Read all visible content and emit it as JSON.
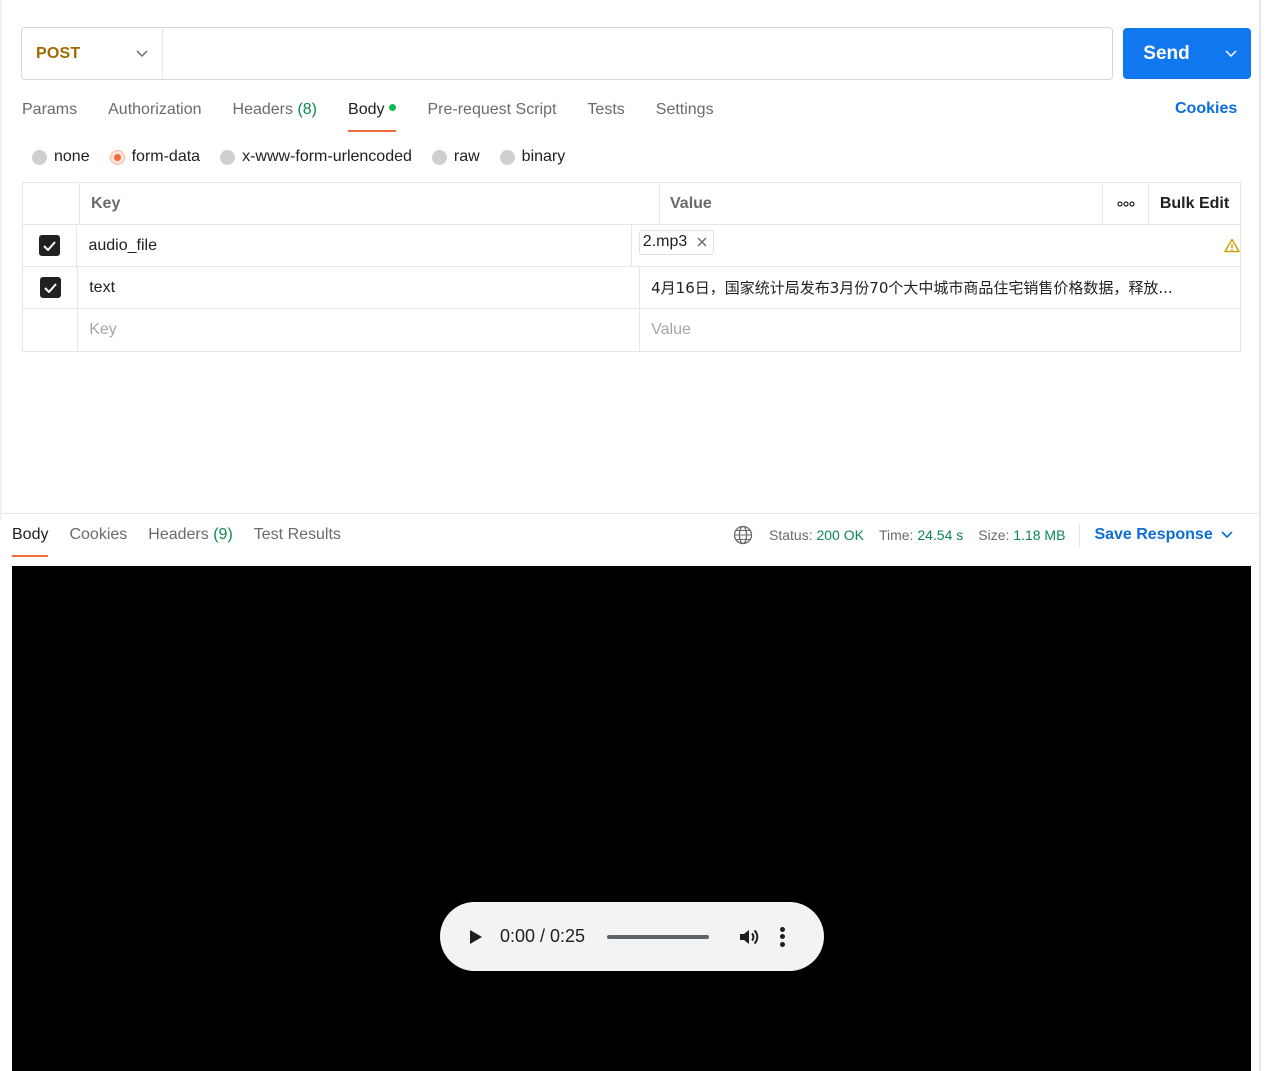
{
  "request": {
    "method": "POST",
    "url": "",
    "send_label": "Send",
    "tabs": [
      {
        "label": "Params"
      },
      {
        "label": "Authorization"
      },
      {
        "label": "Headers",
        "count": "(8)"
      },
      {
        "label": "Body"
      },
      {
        "label": "Pre-request Script"
      },
      {
        "label": "Tests"
      },
      {
        "label": "Settings"
      }
    ],
    "cookies_label": "Cookies",
    "body_types": [
      "none",
      "form-data",
      "x-www-form-urlencoded",
      "raw",
      "binary"
    ],
    "selected_body_type": "form-data"
  },
  "table": {
    "key_header": "Key",
    "value_header": "Value",
    "more_icon": "more-horizontal-icon",
    "bulk_edit_label": "Bulk Edit",
    "rows": [
      {
        "key": "audio_file",
        "value": "2.mp3",
        "type": "file",
        "checked": true
      },
      {
        "key": "text",
        "value": "4月16日，国家统计局发布3月份70个大中城市商品住宅销售价格数据，释放...",
        "type": "text",
        "checked": true
      }
    ],
    "key_placeholder": "Key",
    "value_placeholder": "Value"
  },
  "response": {
    "tabs": [
      {
        "label": "Body"
      },
      {
        "label": "Cookies"
      },
      {
        "label": "Headers",
        "count": "(9)"
      },
      {
        "label": "Test Results"
      }
    ],
    "status_label": "Status:",
    "status_value": "200 OK",
    "time_label": "Time:",
    "time_value": "24.54 s",
    "size_label": "Size:",
    "size_value": "1.18 MB",
    "save_label": "Save Response",
    "audio": {
      "time_display": "0:00 / 0:25"
    }
  },
  "colors": {
    "accent": "#1177ef",
    "method": "#a16a00",
    "tab_underline": "#f26b3a",
    "success": "#0c8a4d"
  }
}
